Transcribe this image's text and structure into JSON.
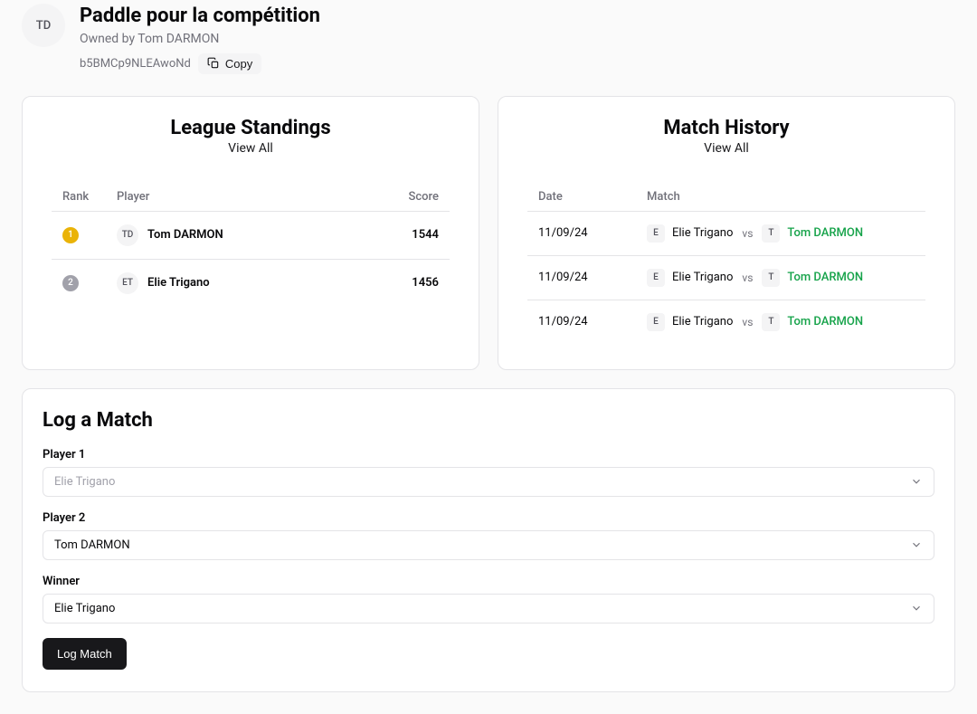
{
  "header": {
    "avatar_initials": "TD",
    "title": "Paddle pour la compétition",
    "owned_by": "Owned by Tom DARMON",
    "league_id": "b5BMCp9NLEAwoNd",
    "copy_label": "Copy"
  },
  "standings": {
    "title": "League Standings",
    "view_all": "View All",
    "columns": {
      "rank": "Rank",
      "player": "Player",
      "score": "Score"
    },
    "rows": [
      {
        "rank": "1",
        "initials": "TD",
        "name": "Tom DARMON",
        "score": "1544"
      },
      {
        "rank": "2",
        "initials": "ET",
        "name": "Elie Trigano",
        "score": "1456"
      }
    ]
  },
  "history": {
    "title": "Match History",
    "view_all": "View All",
    "columns": {
      "date": "Date",
      "match": "Match"
    },
    "vs_label": "vs",
    "rows": [
      {
        "date": "11/09/24",
        "p1_initial": "E",
        "p1_name": "Elie Trigano",
        "p2_initial": "T",
        "p2_name": "Tom DARMON"
      },
      {
        "date": "11/09/24",
        "p1_initial": "E",
        "p1_name": "Elie Trigano",
        "p2_initial": "T",
        "p2_name": "Tom DARMON"
      },
      {
        "date": "11/09/24",
        "p1_initial": "E",
        "p1_name": "Elie Trigano",
        "p2_initial": "T",
        "p2_name": "Tom DARMON"
      }
    ]
  },
  "log_form": {
    "title": "Log a Match",
    "player1_label": "Player 1",
    "player1_value": "Elie Trigano",
    "player2_label": "Player 2",
    "player2_value": "Tom DARMON",
    "winner_label": "Winner",
    "winner_value": "Elie Trigano",
    "submit_label": "Log Match"
  }
}
